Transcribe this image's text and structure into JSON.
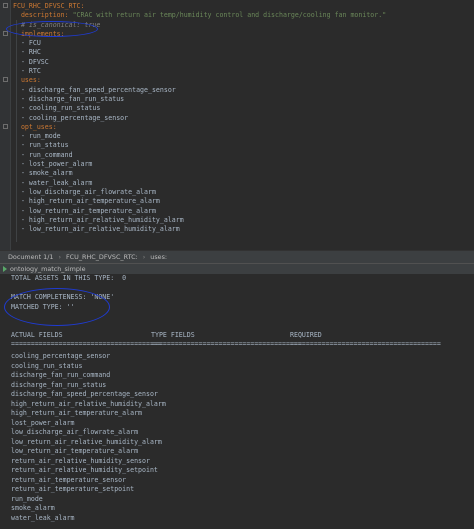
{
  "editor": {
    "lines": [
      {
        "segments": [
          {
            "cls": "k",
            "text": "FCU_RHC_DFVSC_RTC:"
          }
        ]
      },
      {
        "segments": [
          {
            "cls": "v",
            "text": "  "
          },
          {
            "cls": "k",
            "text": "description:"
          },
          {
            "cls": "s",
            "text": " \"CRAC with return air temp/humidity control and discharge/cooling fan monitor.\""
          }
        ]
      },
      {
        "segments": [
          {
            "cls": "v",
            "text": "  "
          },
          {
            "cls": "c",
            "text": "# is_canonical: true"
          }
        ]
      },
      {
        "segments": [
          {
            "cls": "v",
            "text": "  "
          },
          {
            "cls": "k",
            "text": "implements:"
          }
        ]
      },
      {
        "segments": [
          {
            "cls": "v",
            "text": "  - FCU"
          }
        ]
      },
      {
        "segments": [
          {
            "cls": "v",
            "text": "  - RHC"
          }
        ]
      },
      {
        "segments": [
          {
            "cls": "v",
            "text": "  - DFVSC"
          }
        ]
      },
      {
        "segments": [
          {
            "cls": "v",
            "text": "  - RTC"
          }
        ]
      },
      {
        "segments": [
          {
            "cls": "v",
            "text": "  "
          },
          {
            "cls": "k",
            "text": "uses:"
          }
        ]
      },
      {
        "segments": [
          {
            "cls": "v",
            "text": "  - discharge_fan_speed_percentage_sensor"
          }
        ]
      },
      {
        "segments": [
          {
            "cls": "v",
            "text": "  - discharge_fan_run_status"
          }
        ]
      },
      {
        "segments": [
          {
            "cls": "v",
            "text": "  - cooling_run_status"
          }
        ]
      },
      {
        "segments": [
          {
            "cls": "v",
            "text": "  - cooling_percentage_sensor"
          }
        ]
      },
      {
        "segments": [
          {
            "cls": "v",
            "text": "  "
          },
          {
            "cls": "k",
            "text": "opt_uses:"
          }
        ]
      },
      {
        "segments": [
          {
            "cls": "v",
            "text": "  - run_mode"
          }
        ]
      },
      {
        "segments": [
          {
            "cls": "v",
            "text": "  - run_status"
          }
        ]
      },
      {
        "segments": [
          {
            "cls": "v",
            "text": "  - run_command"
          }
        ]
      },
      {
        "segments": [
          {
            "cls": "v",
            "text": "  - lost_power_alarm"
          }
        ]
      },
      {
        "segments": [
          {
            "cls": "v",
            "text": "  - smoke_alarm"
          }
        ]
      },
      {
        "segments": [
          {
            "cls": "v",
            "text": "  - water_leak_alarm"
          }
        ]
      },
      {
        "segments": [
          {
            "cls": "v",
            "text": "  - low_discharge_air_flowrate_alarm"
          }
        ]
      },
      {
        "segments": [
          {
            "cls": "v",
            "text": "  - high_return_air_temperature_alarm"
          }
        ]
      },
      {
        "segments": [
          {
            "cls": "v",
            "text": "  - low_return_air_temperature_alarm"
          }
        ]
      },
      {
        "segments": [
          {
            "cls": "v",
            "text": "  - high_return_air_relative_humidity_alarm"
          }
        ]
      },
      {
        "segments": [
          {
            "cls": "v",
            "text": "  - low_return_air_relative_humidity_alarm"
          }
        ]
      }
    ]
  },
  "breadcrumb": {
    "items": [
      "Document 1/1",
      "FCU_RHC_DFVSC_RTC:",
      "uses:"
    ]
  },
  "run_tab": {
    "label": "ontology_match_simple"
  },
  "console": {
    "total_assets": "TOTAL ASSETS IN THIS TYPE:  0",
    "match_completeness": "MATCH COMPLETENESS: 'NONE'",
    "matched_type": "MATCHED TYPE: ''",
    "headers": [
      "ACTUAL FIELDS",
      "TYPE FIELDS",
      "REQUIRED"
    ],
    "rule": "======================================",
    "actual_fields": [
      "cooling_percentage_sensor",
      "cooling_run_status",
      "discharge_fan_run_command",
      "discharge_fan_run_status",
      "discharge_fan_speed_percentage_sensor",
      "high_return_air_relative_humidity_alarm",
      "high_return_air_temperature_alarm",
      "lost_power_alarm",
      "low_discharge_air_flowrate_alarm",
      "low_return_air_relative_humidity_alarm",
      "low_return_air_temperature_alarm",
      "return_air_relative_humidity_sensor",
      "return_air_relative_humidity_setpoint",
      "return_air_temperature_sensor",
      "return_air_temperature_setpoint",
      "run_mode",
      "smoke_alarm",
      "water_leak_alarm"
    ]
  },
  "colors": {
    "keyword": "#cc7832",
    "string": "#6a8759",
    "comment": "#808080",
    "annotation": "#1f3bd1"
  }
}
